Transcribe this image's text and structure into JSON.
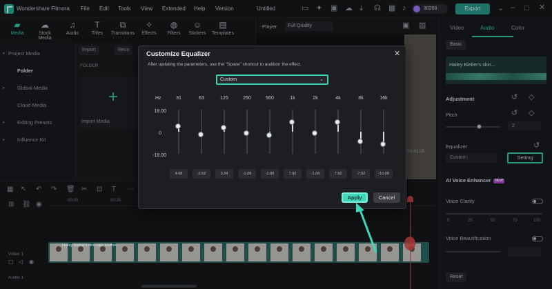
{
  "app": {
    "name": "Wondershare Filmora",
    "menu": [
      "File",
      "Edit",
      "Tools",
      "View",
      "Extended",
      "Help",
      "Version"
    ],
    "project_name": "Untitled",
    "credits": "30268",
    "export_label": "Export"
  },
  "toolbar": {
    "tools": [
      {
        "label": "Media",
        "icon": "folder-icon"
      },
      {
        "label": "Stock Media",
        "icon": "cloud-icon"
      },
      {
        "label": "Audio",
        "icon": "music-icon"
      },
      {
        "label": "Titles",
        "icon": "text-icon"
      },
      {
        "label": "Transitions",
        "icon": "transition-icon"
      },
      {
        "label": "Effects",
        "icon": "effects-icon"
      },
      {
        "label": "Filters",
        "icon": "filter-icon"
      },
      {
        "label": "Stickers",
        "icon": "sticker-icon"
      },
      {
        "label": "Templates",
        "icon": "template-icon"
      }
    ]
  },
  "media_panel": {
    "items": [
      "Project Media",
      "Folder",
      "Global Media",
      "Cloud Media",
      "Editing Presets",
      "Influence Kit"
    ],
    "import_btn": "Import",
    "record_btn": "Reco",
    "folder_header": "FOLDER",
    "import_media": "Import Media"
  },
  "player": {
    "label": "Player",
    "quality": "Full Quality",
    "time": "04:41:05"
  },
  "right_panel": {
    "tabs": [
      "Video",
      "Audio",
      "Color"
    ],
    "basic_btn": "Basic",
    "clip_name": "Hailey Bieber's skin...",
    "adjustment": "Adjustment",
    "pitch": "Pitch",
    "pitch_value": "2",
    "equalizer": "Equalizer",
    "eq_preset": "Custom",
    "setting_btn": "Setting",
    "ai_voice": "AI Voice Enhancer",
    "new_badge": "NEW",
    "voice_clarity": "Voice Clarity",
    "clarity_ticks": [
      "0",
      "25",
      "50",
      "75",
      "100"
    ],
    "voice_beautification": "Voice Beautification",
    "reset_btn": "Reset"
  },
  "timeline": {
    "ruler": [
      "00:00",
      "00:25"
    ],
    "video_track": "Video 1",
    "audio_track": "Audio 1",
    "clip_title": "Hailey Bieber's skin care routine..."
  },
  "dialog": {
    "title": "Customize Equalizer",
    "description": "After updating the parameters, use the \"Space\" shortcut to audition the effect.",
    "preset": "Custom",
    "hz_label": "Hz",
    "db_max": "18.00",
    "db_zero": "0",
    "db_min": "-18.00",
    "bands": [
      {
        "hz": "31",
        "value": "4.68",
        "level": 4.68
      },
      {
        "hz": "63",
        "value": "-2.52",
        "level": -2.52
      },
      {
        "hz": "125",
        "value": "3.24",
        "level": 3.24
      },
      {
        "hz": "250",
        "value": "-1.08",
        "level": -1.08
      },
      {
        "hz": "500",
        "value": "-2.88",
        "level": -2.88
      },
      {
        "hz": "1k",
        "value": "7.92",
        "level": 7.92
      },
      {
        "hz": "2k",
        "value": "-1.08",
        "level": -1.08
      },
      {
        "hz": "4k",
        "value": "7.92",
        "level": 7.92
      },
      {
        "hz": "8k",
        "value": "-7.92",
        "level": -7.92
      },
      {
        "hz": "16k",
        "value": "-10.08",
        "level": -10.08
      }
    ],
    "apply": "Apply",
    "cancel": "Cancel"
  },
  "colors": {
    "accent": "#3ad1b4",
    "export": "#2a9d8f",
    "playhead": "#e04b4b"
  }
}
